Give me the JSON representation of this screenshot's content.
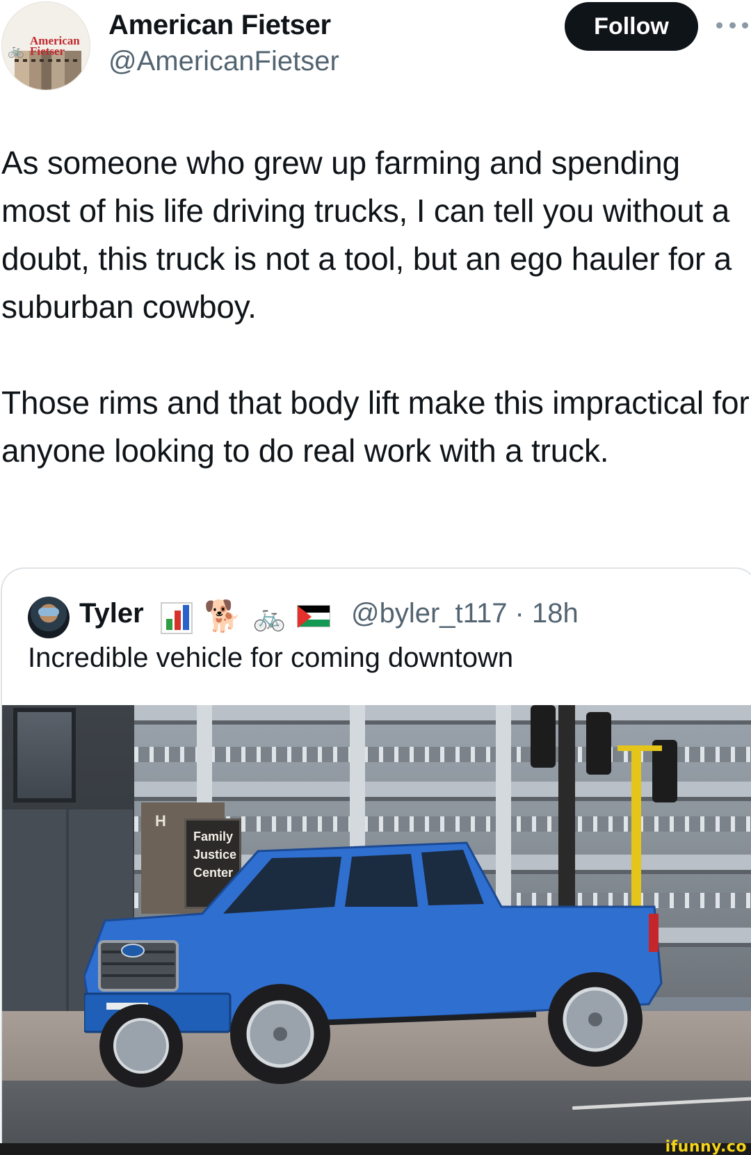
{
  "author": {
    "display_name": "American Fietser",
    "handle": "@AmericanFietser",
    "avatar_text_line1": "American",
    "avatar_text_line2": "Fietser"
  },
  "actions": {
    "follow_label": "Follow",
    "more_icon": "more-horizontal-icon"
  },
  "tweet": {
    "paragraph1": "As someone who grew up farming and spending most of his life driving trucks, I can tell you without a doubt, this truck is not a tool, but an ego hauler for a suburban cowboy.",
    "paragraph2": "Those rims and that body lift make this impractical for anyone looking to do real work with a truck."
  },
  "quoted_tweet": {
    "name": "Tyler",
    "emojis": [
      "bar-chart-emoji",
      "dog-emoji",
      "bicycle-emoji",
      "palestine-flag-emoji"
    ],
    "handle_time": "@byler_t117 · 18h",
    "text": "Incredible vehicle for coming downtown",
    "photo": {
      "sign_line1": "Family",
      "sign_line2": "Justice",
      "sign_line3": "Center",
      "truck_color": "#2f6fd0"
    }
  },
  "watermark": "ifunny.co",
  "colors": {
    "text_primary": "#0f1419",
    "text_secondary": "#536471",
    "follow_bg": "#0f1419",
    "border": "#dfe3e6",
    "watermark": "#f6d317"
  }
}
